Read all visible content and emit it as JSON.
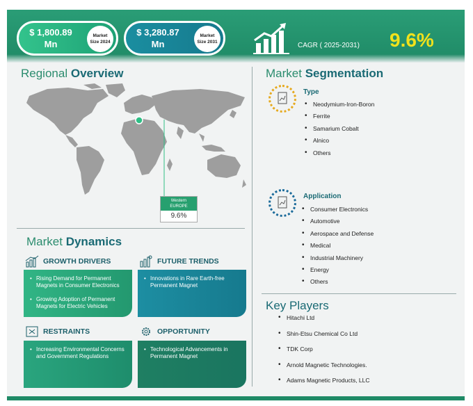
{
  "header": {
    "market_size_2024": {
      "value": "$ 1,800.89 Mn",
      "value_line1": "$ 1,800.89",
      "value_line2": "Mn",
      "badge_line1": "Market",
      "badge_line2": "Size 2024"
    },
    "market_size_2031": {
      "value": "$ 3,280.87 Mn",
      "value_line1": "$ 3,280.87",
      "value_line2": "Mn",
      "badge_line1": "Market",
      "badge_line2": "Size 2031"
    },
    "cagr_label": "CAGR ( 2025-2031)",
    "cagr_value": "9.6%"
  },
  "regional": {
    "title_a": "Regional",
    "title_b": "Overview",
    "region_line1": "Western",
    "region_line2": "EUROPE",
    "region_value": "9.6%"
  },
  "dynamics": {
    "title_a": "Market",
    "title_b": "Dynamics",
    "growth_drivers": {
      "label": "GROWTH DRIVERS",
      "items": [
        "Rising Demand for Permanent Magnets in Consumer Electronics",
        "Growing Adoption of Permanent Magnets for Electric Vehicles"
      ]
    },
    "future_trends": {
      "label": "FUTURE TRENDS",
      "items": [
        "Innovations in Rare Earth-free Permanent Magnet"
      ]
    },
    "restraints": {
      "label": "RESTRAINTS",
      "items": [
        "Increasing Environmental Concerns and Government Regulations"
      ]
    },
    "opportunity": {
      "label": "OPPORTUNITY",
      "items": [
        "Technological Advancements in Permanent Magnet"
      ]
    }
  },
  "segmentation": {
    "title_a": "Market",
    "title_b": "Segmentation",
    "type": {
      "label": "Type",
      "items": [
        "Neodymium-Iron-Boron",
        "Ferrite",
        "Samarium Cobalt",
        "Alnico",
        "Others"
      ]
    },
    "application": {
      "label": "Application",
      "items": [
        "Consumer Electronics",
        "Automotive",
        "Aerospace and Defense",
        "Medical",
        "Industrial Machinery",
        "Energy",
        "Others"
      ]
    }
  },
  "key_players": {
    "title": "Key Players",
    "items": [
      "Hitachi Ltd",
      "Shin-Etsu Chemical Co Ltd",
      "TDK Corp",
      "Arnold Magnetic Technologies.",
      "Adams Magnetic Products, LLC"
    ]
  },
  "colors": {
    "primary_green": "#1f8a66",
    "teal": "#167a8e",
    "accent_yellow": "#f1e21c",
    "dark_green_card": "#1a7560"
  }
}
